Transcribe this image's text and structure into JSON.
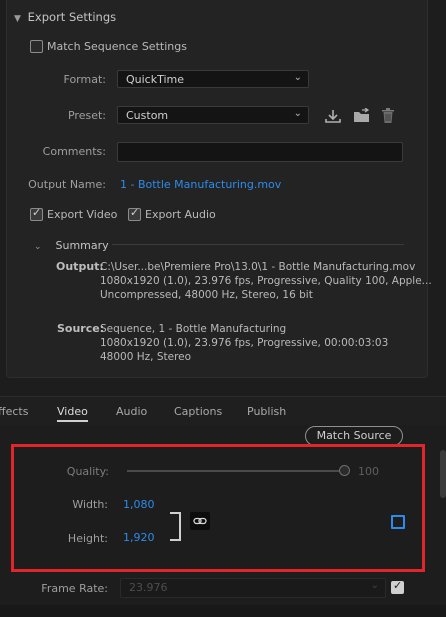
{
  "export_settings": {
    "title": "Export Settings",
    "match_sequence": {
      "label": "Match Sequence Settings",
      "checked": false
    },
    "format": {
      "label": "Format:",
      "value": "QuickTime"
    },
    "preset": {
      "label": "Preset:",
      "value": "Custom"
    },
    "comments": {
      "label": "Comments:",
      "value": ""
    },
    "output_name": {
      "label": "Output Name:",
      "value": "1 - Bottle Manufacturing.mov"
    },
    "export_video": {
      "label": "Export Video",
      "checked": true
    },
    "export_audio": {
      "label": "Export Audio",
      "checked": true
    },
    "summary": {
      "title": "Summary",
      "output_label": "Output:",
      "output_lines": [
        "C:\\User...be\\Premiere Pro\\13.0\\1 - Bottle Manufacturing.mov",
        "1080x1920 (1.0), 23.976 fps, Progressive, Quality 100, Apple...",
        "Uncompressed, 48000 Hz, Stereo, 16 bit"
      ],
      "source_label": "Source:",
      "source_lines": [
        "Sequence, 1 - Bottle Manufacturing",
        "1080x1920 (1.0), 23.976 fps, Progressive, 00:00:03:03",
        "48000 Hz, Stereo"
      ]
    }
  },
  "tabs": [
    "ffects",
    "Video",
    "Audio",
    "Captions",
    "Publish"
  ],
  "video": {
    "match_source": "Match Source",
    "quality": {
      "label": "Quality:",
      "value": "100",
      "fraction": 1.0
    },
    "width": {
      "label": "Width:",
      "value": "1,080"
    },
    "height": {
      "label": "Height:",
      "value": "1,920"
    },
    "frame_rate": {
      "label": "Frame Rate:",
      "value": "23.976"
    }
  },
  "icons": [
    "chevron-down-icon",
    "save-preset-icon",
    "import-preset-icon",
    "delete-preset-icon",
    "link-icon",
    "checkbox-icon"
  ],
  "colors": {
    "accent": "#2d8ceb",
    "highlight": "#e0262b",
    "background": "#1d1d1d"
  }
}
